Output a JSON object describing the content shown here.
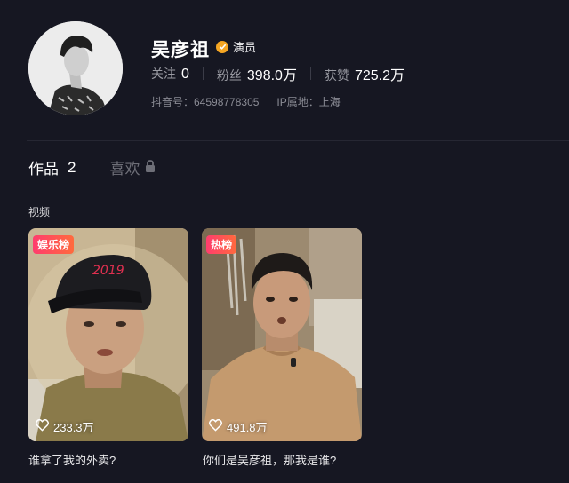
{
  "profile": {
    "name": "吴彦祖",
    "verified_label": "演员",
    "stats": [
      {
        "label": "关注",
        "value": "0"
      },
      {
        "label": "粉丝",
        "value": "398.0万"
      },
      {
        "label": "获赞",
        "value": "725.2万"
      }
    ],
    "douyin_id": "抖音号：64598778305",
    "ip_location": "IP属地：上海"
  },
  "tabs": {
    "works_label": "作品",
    "works_count": "2",
    "likes_label": "喜欢"
  },
  "section_label": "视频",
  "videos": [
    {
      "tag": "娱乐榜",
      "likes": "233.3万",
      "caption": "谁拿了我的外卖?"
    },
    {
      "tag": "热榜",
      "likes": "491.8万",
      "caption": "你们是吴彦祖，那我是谁?"
    }
  ],
  "colors": {
    "background": "#161722",
    "verify_badge": "#f5a623",
    "tag_gradient_start": "#ff3d6e",
    "tag_gradient_end": "#ff6a3d"
  },
  "icons": [
    "verified-badge-icon",
    "lock-icon",
    "heart-icon"
  ]
}
